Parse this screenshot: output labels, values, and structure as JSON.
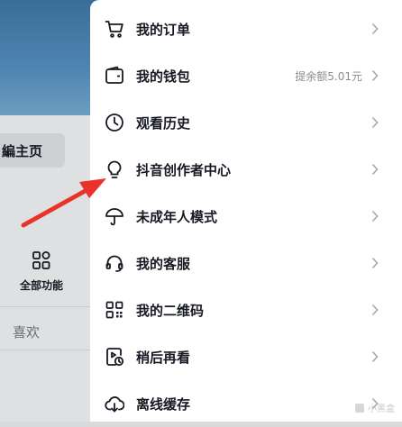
{
  "left": {
    "edit_profile": "編主页",
    "all_functions": "全部功能",
    "likes_tab": "喜欢"
  },
  "menu": [
    {
      "icon": "cart-icon",
      "label": "我的订单"
    },
    {
      "icon": "wallet-icon",
      "label": "我的钱包",
      "extra": "提余额5.01元"
    },
    {
      "icon": "clock-icon",
      "label": "观看历史"
    },
    {
      "icon": "lightbulb-icon",
      "label": "抖音创作者中心"
    },
    {
      "icon": "umbrella-icon",
      "label": "未成年人模式"
    },
    {
      "icon": "headset-icon",
      "label": "我的客服"
    },
    {
      "icon": "qrcode-icon",
      "label": "我的二维码"
    },
    {
      "icon": "watch-later-icon",
      "label": "稍后再看"
    },
    {
      "icon": "cloud-download-icon",
      "label": "离线缓存"
    }
  ],
  "watermark": "小黑盒",
  "colors": {
    "annotation_arrow": "#e8322a",
    "text": "#161823",
    "secondary": "#8a8b91"
  }
}
